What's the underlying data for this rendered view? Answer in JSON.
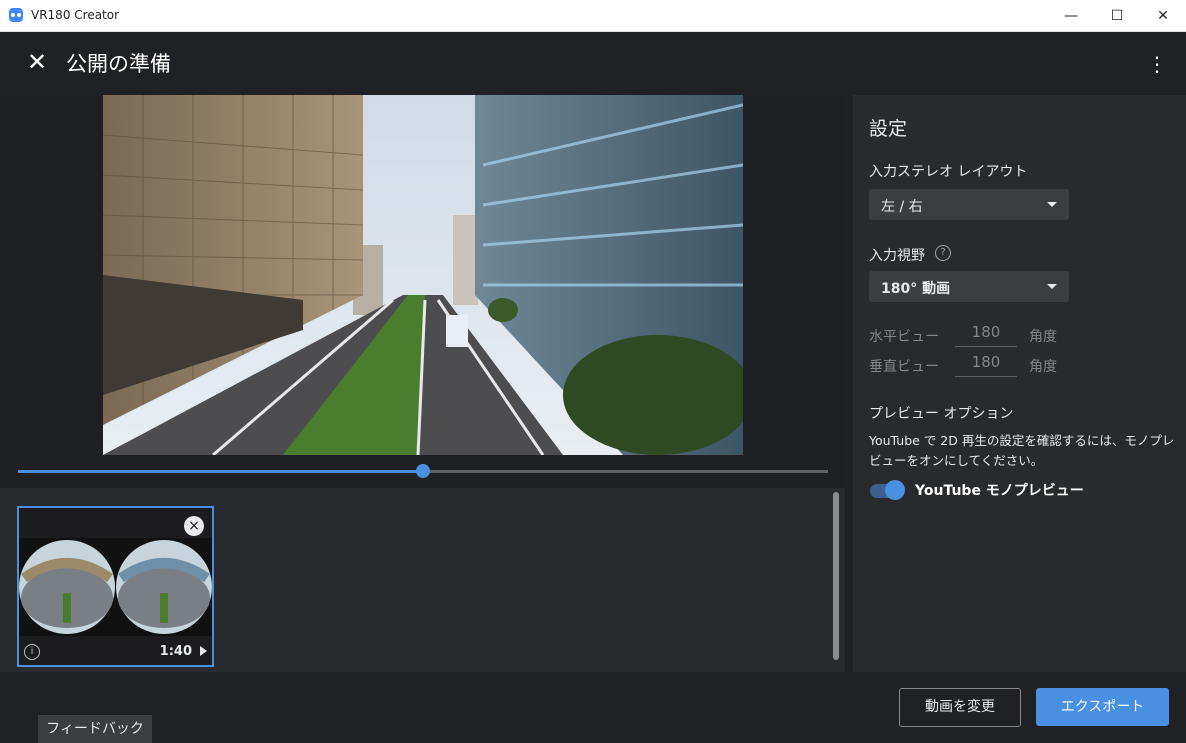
{
  "window": {
    "title": "VR180 Creator",
    "minimize_glyph": "—",
    "maximize_glyph": "☐",
    "close_glyph": "✕"
  },
  "appbar": {
    "close_glyph": "✕",
    "title": "公開の準備",
    "menu_glyph": "⋮"
  },
  "player": {
    "progress": 0.5
  },
  "clip": {
    "remove_glyph": "×",
    "info_glyph": "i",
    "duration": "1:40"
  },
  "settings": {
    "title": "設定",
    "stereo_label": "入力ステレオ レイアウト",
    "stereo_value": "左 / 右",
    "fov_label": "入力視野",
    "fov_help_glyph": "?",
    "fov_value": "180° 動画",
    "horizontal_label": "水平ビュー",
    "horizontal_value": "180",
    "vertical_label": "垂直ビュー",
    "vertical_value": "180",
    "unit": "角度",
    "preview_title": "プレビュー オプション",
    "preview_desc": "YouTube で 2D 再生の設定を確認するには、モノプレビューをオンにしてください。",
    "mono_toggle_label": "YouTube モノプレビュー",
    "mono_toggle_on": true
  },
  "footer": {
    "change_video": "動画を変更",
    "export": "エクスポート",
    "feedback": "フィードバック"
  },
  "colors": {
    "accent": "#4a90e2",
    "panel": "#292a2d",
    "background": "#202124"
  }
}
